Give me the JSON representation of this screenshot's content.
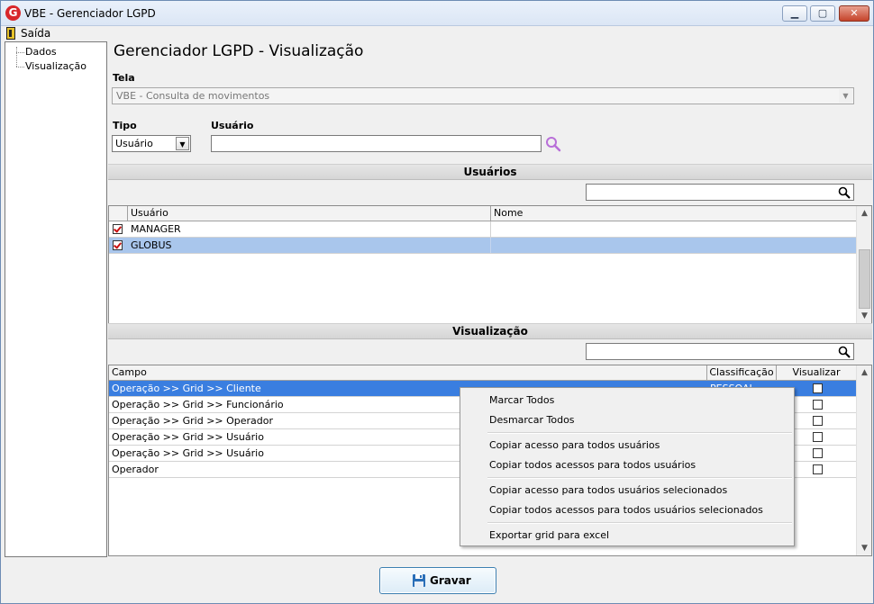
{
  "window": {
    "title": "VBE - Gerenciador LGPD",
    "minimize_glyph": "▁",
    "maximize_glyph": "▢",
    "close_glyph": "✕",
    "app_icon_letter": "G"
  },
  "menu": {
    "exit_label": "Saída"
  },
  "tree": {
    "items": [
      "Dados",
      "Visualização"
    ]
  },
  "page": {
    "title": "Gerenciador LGPD - Visualização"
  },
  "form": {
    "tela_label": "Tela",
    "tela_value": "VBE - Consulta de movimentos",
    "tipo_label": "Tipo",
    "tipo_value": "Usuário",
    "usuario_label": "Usuário",
    "usuario_value": ""
  },
  "usuarios_section": {
    "title": "Usuários",
    "columns": [
      "Usuário",
      "Nome"
    ],
    "rows": [
      {
        "usuario": "MANAGER",
        "nome": "",
        "checked": true
      },
      {
        "usuario": "GLOBUS",
        "nome": "",
        "checked": true
      }
    ]
  },
  "visualizacao_section": {
    "title": "Visualização",
    "columns": [
      "Campo",
      "Classificação",
      "Visualizar"
    ],
    "rows": [
      {
        "campo": "Operação >> Grid >> Cliente",
        "classificacao": "PESSOAL",
        "visualizar": false
      },
      {
        "campo": "Operação >> Grid >> Funcionário",
        "classificacao": "",
        "visualizar": false
      },
      {
        "campo": "Operação >> Grid >> Operador",
        "classificacao": "",
        "visualizar": false
      },
      {
        "campo": "Operação >> Grid >> Usuário",
        "classificacao": "",
        "visualizar": false
      },
      {
        "campo": "Operação >> Grid >> Usuário",
        "classificacao": "",
        "visualizar": false
      },
      {
        "campo": "Operador",
        "classificacao": "",
        "visualizar": false
      }
    ]
  },
  "context_menu": {
    "items": [
      "Marcar Todos",
      "Desmarcar Todos",
      "Copiar acesso para todos usuários",
      "Copiar todos acessos para todos usuários",
      "Copiar acesso para todos usuários selecionados",
      "Copiar todos acessos para todos usuários selecionados",
      "Exportar grid para excel"
    ]
  },
  "footer": {
    "save_label": "Gravar"
  },
  "colors": {
    "selected_row_user": "#a9c6ec",
    "selected_row_field": "#3a7ee0",
    "checkbox_check": "#c81010",
    "search_icon_purple": "#b86fd8"
  }
}
